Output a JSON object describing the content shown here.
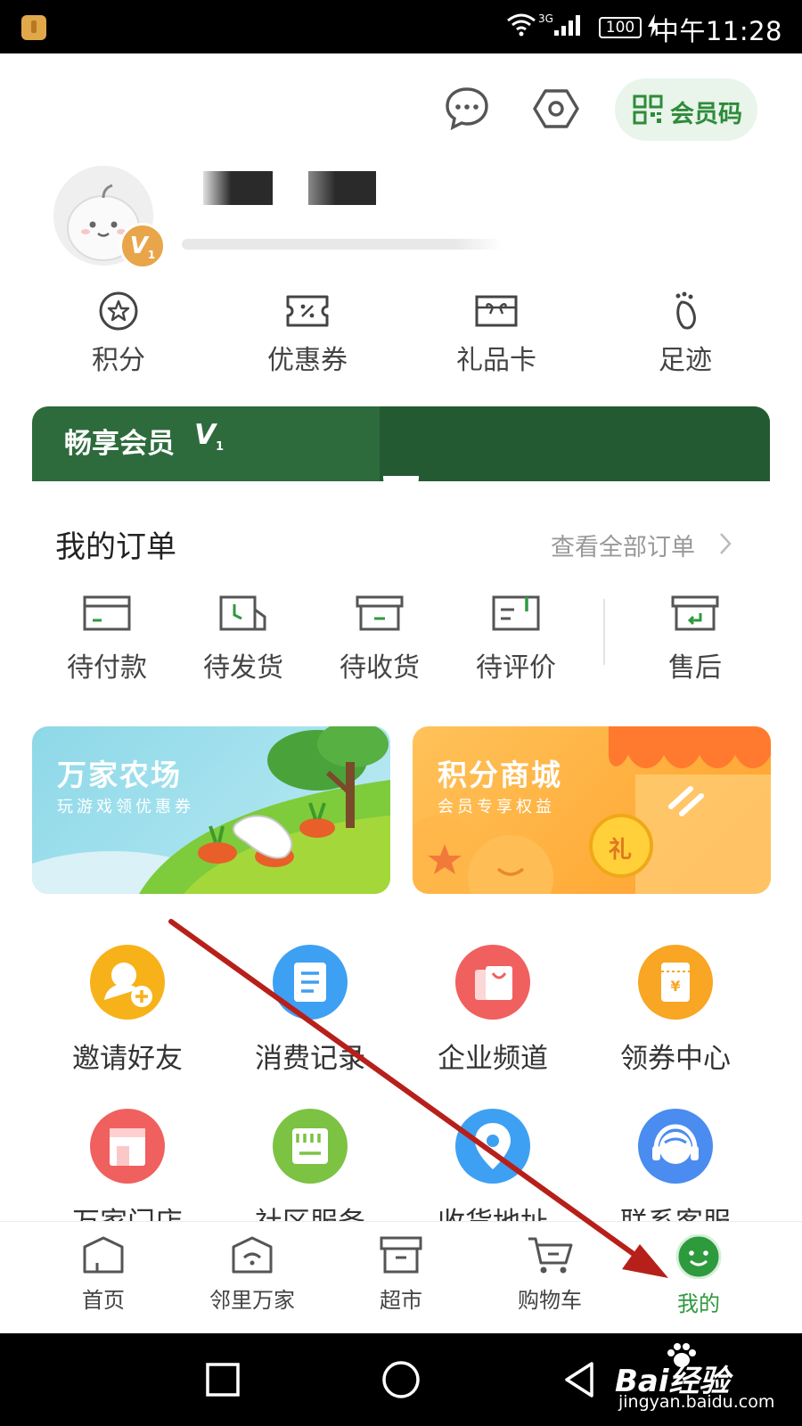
{
  "status_bar": {
    "network": "3G",
    "battery": "100",
    "time": "中午11:28"
  },
  "header": {
    "message_icon": "chat-bubble-icon",
    "settings_icon": "hexagon-settings-icon",
    "member_code_label": "会员码"
  },
  "profile": {
    "level_badge": "V",
    "level_number": "1"
  },
  "quick_links": [
    {
      "label": "积分",
      "icon": "star-circle-icon"
    },
    {
      "label": "优惠券",
      "icon": "coupon-icon"
    },
    {
      "label": "礼品卡",
      "icon": "gift-card-icon"
    },
    {
      "label": "足迹",
      "icon": "footprint-icon"
    }
  ],
  "member_banner": {
    "title": "畅享会员",
    "level": "V",
    "level_number": "1"
  },
  "orders": {
    "title": "我的订单",
    "view_all": "查看全部订单",
    "items": [
      {
        "label": "待付款",
        "icon": "wallet-icon"
      },
      {
        "label": "待发货",
        "icon": "package-clock-icon"
      },
      {
        "label": "待收货",
        "icon": "box-icon"
      },
      {
        "label": "待评价",
        "icon": "review-icon"
      },
      {
        "label": "售后",
        "icon": "return-box-icon"
      }
    ]
  },
  "promos": {
    "farm": {
      "title": "万家农场",
      "subtitle": "玩游戏领优惠券"
    },
    "mall": {
      "title": "积分商城",
      "subtitle": "会员专享权益",
      "coin_text": "礼"
    }
  },
  "services": [
    {
      "label": "邀请好友",
      "icon": "invite-user-icon",
      "color": "#f7b21a"
    },
    {
      "label": "消费记录",
      "icon": "receipt-icon",
      "color": "#3ea0f2"
    },
    {
      "label": "企业频道",
      "icon": "shopping-bag-icon",
      "color": "#f0605e"
    },
    {
      "label": "领券中心",
      "icon": "coupon-bag-icon",
      "color": "#f8a623"
    },
    {
      "label": "万家门店",
      "icon": "store-icon",
      "color": "#f0605e"
    },
    {
      "label": "社区服务",
      "icon": "community-icon",
      "color": "#7cc243"
    },
    {
      "label": "收货地址",
      "icon": "location-pin-icon",
      "color": "#3ea0f2"
    },
    {
      "label": "联系客服",
      "icon": "headset-icon",
      "color": "#4a8cf0"
    }
  ],
  "tab_bar": [
    {
      "label": "首页",
      "icon": "home-icon",
      "active": false
    },
    {
      "label": "邻里万家",
      "icon": "neighbor-icon",
      "active": false
    },
    {
      "label": "超市",
      "icon": "supermarket-icon",
      "active": false
    },
    {
      "label": "购物车",
      "icon": "cart-icon",
      "active": false
    },
    {
      "label": "我的",
      "icon": "smiley-profile-icon",
      "active": true
    }
  ],
  "watermark": {
    "main": "Bai经验",
    "sub": "jingyan.baidu.com"
  },
  "colors": {
    "brand_green": "#2e9a3e",
    "banner_green": "#2d6b3c",
    "annotation_red": "#c0201a"
  }
}
